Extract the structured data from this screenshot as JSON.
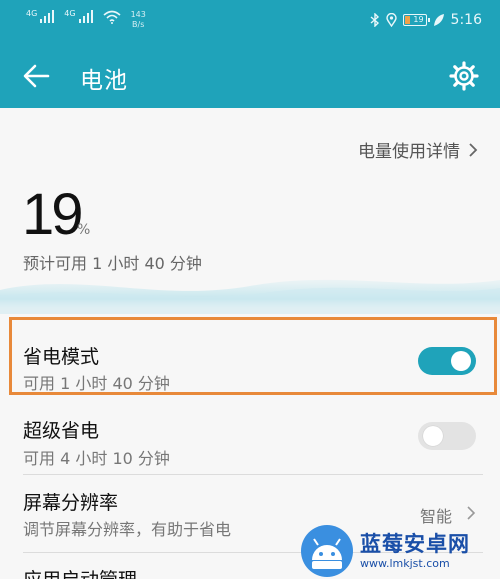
{
  "status_bar": {
    "signal_1_label": "4G",
    "signal_2_label": "4G",
    "net_speed_value": "143",
    "net_speed_unit": "B/s",
    "battery_level": "19",
    "time": "5:16",
    "icons": [
      "signal-icon",
      "signal-icon",
      "wifi-icon",
      "bluetooth-icon",
      "location-icon",
      "battery-icon",
      "leaf-icon"
    ]
  },
  "header": {
    "title": "电池",
    "back_icon": "back-arrow-icon",
    "settings_icon": "gear-icon"
  },
  "summary": {
    "details_link": "电量使用详情",
    "percent": "19",
    "percent_unit": "%",
    "estimate": "预计可用 1 小时 40 分钟"
  },
  "settings": [
    {
      "title": "省电模式",
      "subtitle": "可用 1 小时 40 分钟",
      "toggle_on": true
    },
    {
      "title": "超级省电",
      "subtitle": "可用 4 小时 10 分钟",
      "toggle_on": false
    },
    {
      "title": "屏幕分辨率",
      "subtitle": "调节屏幕分辨率，有助于省电",
      "value": "智能"
    },
    {
      "title": "应用启动管理"
    }
  ],
  "watermark": {
    "name": "蓝莓安卓网",
    "url": "www.lmkjst.com"
  },
  "colors": {
    "primary": "#1fa3ba",
    "highlight_border": "#e8893a",
    "toggle_off": "#e3e3e3",
    "background": "#f7f7f7"
  }
}
